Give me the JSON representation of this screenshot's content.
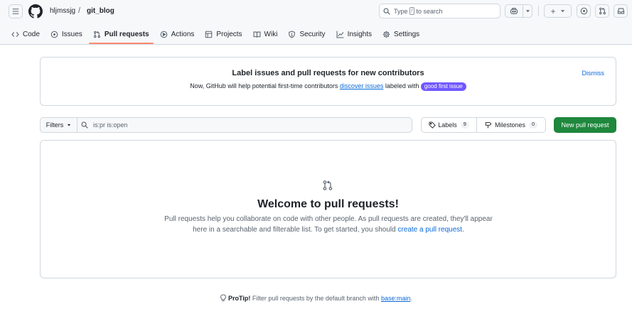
{
  "header": {
    "owner": "hljmssjg",
    "separator": "/",
    "repo": "git_blog",
    "search": {
      "prefix": "Type",
      "key": "/",
      "suffix": "to search"
    },
    "create_label": "+"
  },
  "tabs": [
    {
      "label": "Code",
      "icon": "code-icon"
    },
    {
      "label": "Issues",
      "icon": "issue-opened-icon"
    },
    {
      "label": "Pull requests",
      "icon": "git-pull-request-icon",
      "selected": true
    },
    {
      "label": "Actions",
      "icon": "play-icon"
    },
    {
      "label": "Projects",
      "icon": "table-icon"
    },
    {
      "label": "Wiki",
      "icon": "book-icon"
    },
    {
      "label": "Security",
      "icon": "shield-icon"
    },
    {
      "label": "Insights",
      "icon": "graph-icon"
    },
    {
      "label": "Settings",
      "icon": "gear-icon"
    }
  ],
  "banner": {
    "title": "Label issues and pull requests for new contributors",
    "text_before": "Now, GitHub will help potential first-time contributors ",
    "link": "discover issues",
    "text_after": " labeled with ",
    "badge": "good first issue",
    "badge_color": "#7057ff",
    "dismiss": "Dismiss"
  },
  "filterbar": {
    "filters_label": "Filters",
    "query": "is:pr is:open",
    "labels_label": "Labels",
    "labels_count": "9",
    "milestones_label": "Milestones",
    "milestones_count": "0",
    "new_pr_label": "New pull request"
  },
  "blankslate": {
    "title": "Welcome to pull requests!",
    "text": "Pull requests help you collaborate on code with other people. As pull requests are created, they'll appear here in a searchable and filterable list. To get started, you should ",
    "link": "create a pull request",
    "text_end": "."
  },
  "protip": {
    "label": "ProTip!",
    "text": " Filter pull requests by the default branch with ",
    "link": "base:main",
    "end": "."
  },
  "colors": {
    "accent": "#0969da",
    "primary_button": "#1f883d",
    "selected_tab_underline": "#fd8c73"
  }
}
